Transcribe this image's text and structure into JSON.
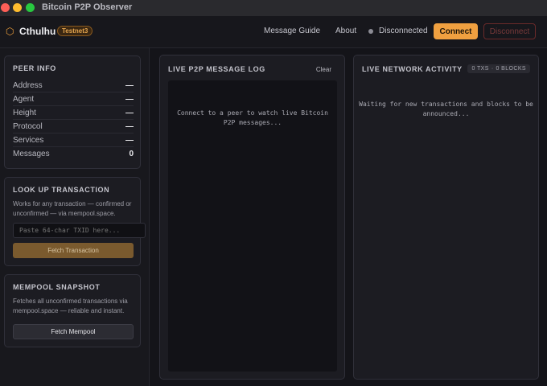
{
  "window": {
    "title": "Bitcoin P2P Observer"
  },
  "header": {
    "brand": "Cthulhu",
    "network_badge": "Testnet3",
    "nav": {
      "guide": "Message Guide",
      "about": "About"
    },
    "status": "Disconnected",
    "connect_label": "Connect",
    "disconnect_label": "Disconnect"
  },
  "peer_info": {
    "title": "PEER INFO",
    "rows": [
      {
        "label": "Address",
        "value": "—"
      },
      {
        "label": "Agent",
        "value": "—"
      },
      {
        "label": "Height",
        "value": "—"
      },
      {
        "label": "Protocol",
        "value": "—"
      },
      {
        "label": "Services",
        "value": "—"
      },
      {
        "label": "Messages",
        "value": "0"
      }
    ]
  },
  "lookup": {
    "title": "LOOK UP TRANSACTION",
    "description": "Works for any transaction — confirmed or unconfirmed — via mempool.space.",
    "input_placeholder": "Paste 64-char TXID here...",
    "button_label": "Fetch Transaction"
  },
  "mempool": {
    "title": "MEMPOOL SNAPSHOT",
    "description": "Fetches all unconfirmed transactions via mempool.space — reliable and instant.",
    "button_label": "Fetch Mempool"
  },
  "log_panel": {
    "title": "LIVE P2P MESSAGE LOG",
    "clear_label": "Clear",
    "empty_message": "Connect to a peer to watch live Bitcoin P2P messages..."
  },
  "network_panel": {
    "title": "LIVE NETWORK ACTIVITY",
    "tx_count": "0 TXS",
    "separator": "·",
    "block_count": "0 BLOCKS",
    "empty_message": "Waiting for new transactions and blocks to be announced..."
  },
  "colors": {
    "accent": "#f0a040",
    "status_dot": "#8c8c95",
    "disconnect_border": "#6a2a2a"
  },
  "icons": {
    "logo": "hexagon-icon"
  }
}
